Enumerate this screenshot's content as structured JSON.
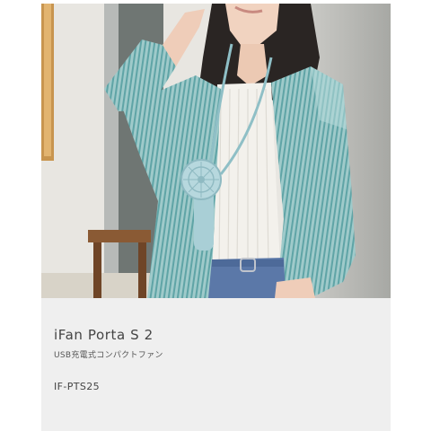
{
  "product": {
    "name": "iFan Porta S 2",
    "description": "USB充電式コンパクトファン",
    "model": "IF-PTS25"
  },
  "photo": {
    "subject": "woman-wearing-neck-fan",
    "colors": {
      "background_wall": "#d9d9d6",
      "shirt": "#7fb8ba",
      "fan": "#a9cfd6",
      "jeans": "#5b78a8"
    }
  }
}
